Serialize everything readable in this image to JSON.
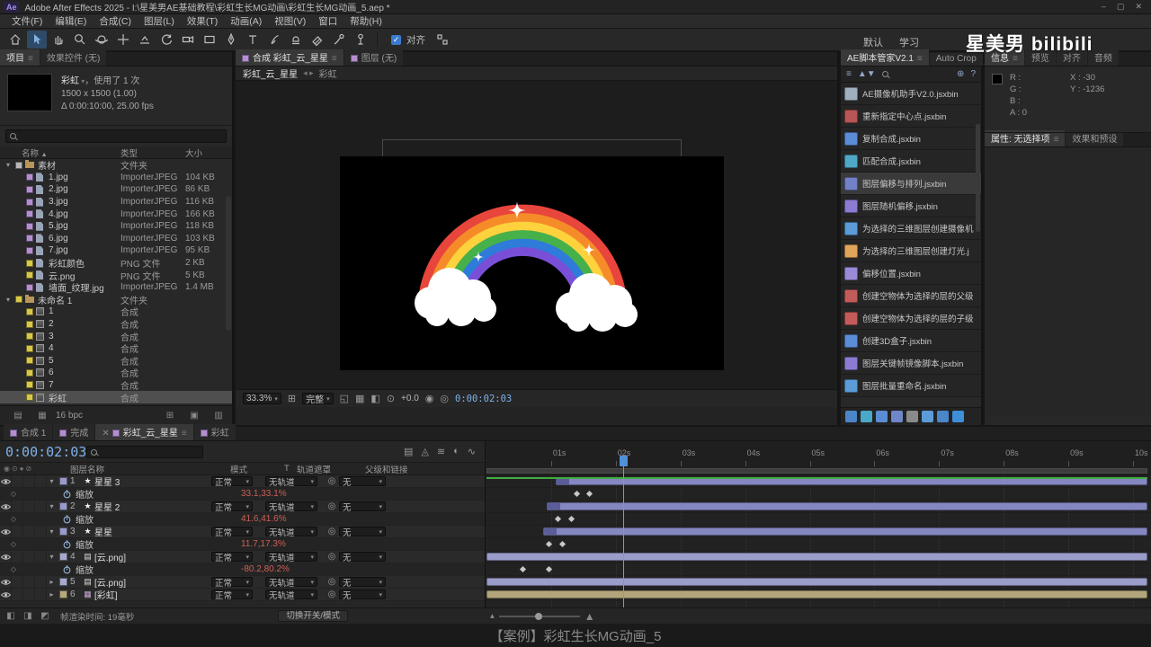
{
  "window": {
    "app_badge": "Ae",
    "title": "Adobe After Effects 2025 - I:\\星美男AE基础教程\\彩虹生长MG动画\\彩虹生长MG动画_5.aep *",
    "controls": [
      "–",
      "▢",
      "✕"
    ]
  },
  "menu": {
    "items": [
      "文件(F)",
      "编辑(E)",
      "合成(C)",
      "图层(L)",
      "效果(T)",
      "动画(A)",
      "视图(V)",
      "窗口",
      "帮助(H)"
    ]
  },
  "toolbar": {
    "snap_label": "对齐"
  },
  "workspace": {
    "items": [
      "默认",
      "学习"
    ],
    "watermark": "星美男  bilibili"
  },
  "project": {
    "tabs": [
      {
        "label": "项目",
        "active": true
      },
      {
        "label": "效果控件 (无)",
        "active": false
      }
    ],
    "preview": {
      "title": "彩虹",
      "usage": "，使用了 1 次",
      "dims": "1500 x 1500 (1.00)",
      "duration": "Δ 0:00:10:00, 25.00 fps"
    },
    "columns": {
      "name": "名称",
      "sort": "▲",
      "type": "类型",
      "size": "大小"
    },
    "items": [
      {
        "indent": 0,
        "kind": "folder",
        "open": true,
        "chip": "#b8b8b8",
        "name": "素材",
        "type": "文件夹",
        "size": ""
      },
      {
        "indent": 1,
        "kind": "footage",
        "chip": "#b48fd0",
        "name": "1.jpg",
        "type": "ImporterJPEG",
        "size": "104 KB"
      },
      {
        "indent": 1,
        "kind": "footage",
        "chip": "#b48fd0",
        "name": "2.jpg",
        "type": "ImporterJPEG",
        "size": "86 KB"
      },
      {
        "indent": 1,
        "kind": "footage",
        "chip": "#b48fd0",
        "name": "3.jpg",
        "type": "ImporterJPEG",
        "size": "116 KB"
      },
      {
        "indent": 1,
        "kind": "footage",
        "chip": "#b48fd0",
        "name": "4.jpg",
        "type": "ImporterJPEG",
        "size": "166 KB"
      },
      {
        "indent": 1,
        "kind": "footage",
        "chip": "#b48fd0",
        "name": "5.jpg",
        "type": "ImporterJPEG",
        "size": "118 KB"
      },
      {
        "indent": 1,
        "kind": "footage",
        "chip": "#b48fd0",
        "name": "6.jpg",
        "type": "ImporterJPEG",
        "size": "103 KB"
      },
      {
        "indent": 1,
        "kind": "footage",
        "chip": "#b48fd0",
        "name": "7.jpg",
        "type": "ImporterJPEG",
        "size": "95 KB"
      },
      {
        "indent": 1,
        "kind": "footage",
        "chip": "#d8c84a",
        "name": "彩虹颜色",
        "type": "PNG 文件",
        "size": "2 KB"
      },
      {
        "indent": 1,
        "kind": "footage",
        "chip": "#d8c84a",
        "name": "云.png",
        "type": "PNG 文件",
        "size": "5 KB"
      },
      {
        "indent": 1,
        "kind": "footage",
        "chip": "#b48fd0",
        "name": "墙面_纹理.jpg",
        "type": "ImporterJPEG",
        "size": "1.4 MB"
      },
      {
        "indent": 0,
        "kind": "folder",
        "open": true,
        "chip": "#d8c84a",
        "name": "未命名 1",
        "type": "文件夹",
        "size": ""
      },
      {
        "indent": 1,
        "kind": "comp",
        "chip": "#d8c84a",
        "name": "1",
        "type": "合成",
        "size": ""
      },
      {
        "indent": 1,
        "kind": "comp",
        "chip": "#d8c84a",
        "name": "2",
        "type": "合成",
        "size": ""
      },
      {
        "indent": 1,
        "kind": "comp",
        "chip": "#d8c84a",
        "name": "3",
        "type": "合成",
        "size": ""
      },
      {
        "indent": 1,
        "kind": "comp",
        "chip": "#d8c84a",
        "name": "4",
        "type": "合成",
        "size": ""
      },
      {
        "indent": 1,
        "kind": "comp",
        "chip": "#d8c84a",
        "name": "5",
        "type": "合成",
        "size": ""
      },
      {
        "indent": 1,
        "kind": "comp",
        "chip": "#d8c84a",
        "name": "6",
        "type": "合成",
        "size": ""
      },
      {
        "indent": 1,
        "kind": "comp",
        "chip": "#d8c84a",
        "name": "7",
        "type": "合成",
        "size": ""
      },
      {
        "indent": 1,
        "kind": "comp",
        "chip": "#d8c84a",
        "name": "彩虹",
        "type": "合成",
        "size": "",
        "selected": true
      }
    ],
    "footer": {
      "bpc": "16 bpc"
    }
  },
  "comp": {
    "tabs": [
      {
        "label": "合成 彩虹_云_星星",
        "active": true
      },
      {
        "label": "图层 (无)",
        "active": false
      }
    ],
    "nav": {
      "current": "彩虹_云_星星",
      "arrows": "◂ ▸",
      "other": "彩虹"
    },
    "controls": {
      "zoom": "33.3%",
      "resolution": "完整",
      "exposure": "+0.0",
      "timecode": "0:00:02:03"
    }
  },
  "viewport": {
    "bg": "#000000",
    "rainbow_colors": [
      "#e8453c",
      "#f68b29",
      "#fdd23c",
      "#46b14a",
      "#2f7bd9",
      "#7a4fd8"
    ],
    "cloud_color": "#ffffff",
    "star_color": "#ffffff"
  },
  "scripts": {
    "tabs": [
      {
        "label": "AE脚本管家V2.1",
        "active": true
      },
      {
        "label": "Auto Crop",
        "active": false
      }
    ],
    "items": [
      {
        "label": "AE摄像机助手V2.0.jsxbin",
        "color": "#9fb0c0"
      },
      {
        "label": "重新指定中心点.jsxbin",
        "color": "#b85555"
      },
      {
        "label": "复制合成.jsxbin",
        "color": "#5b8dd6"
      },
      {
        "label": "匹配合成.jsxbin",
        "color": "#4fa8c8"
      },
      {
        "label": "图层偏移与排列.jsxbin",
        "color": "#7381c9",
        "highlight": true
      },
      {
        "label": "图层随机偏移.jsxbin",
        "color": "#8d7bd3"
      },
      {
        "label": "为选择的三维图层创建摄像机",
        "color": "#5b9bd8"
      },
      {
        "label": "为选择的三维图层创建灯光.j",
        "color": "#e0a558"
      },
      {
        "label": "偏移位置.jsxbin",
        "color": "#9a8ad8"
      },
      {
        "label": "创建空物体为选择的层的父级",
        "color": "#c45b5b"
      },
      {
        "label": "创建空物体为选择的层的子级",
        "color": "#c45b5b"
      },
      {
        "label": "创建3D盒子.jsxbin",
        "color": "#5b8dd6"
      },
      {
        "label": "图层关键帧镜像脚本.jsxbin",
        "color": "#8d7bd3"
      },
      {
        "label": "图层批量重命名.jsxbin",
        "color": "#5b9bd8"
      }
    ],
    "quick_icons": [
      "#4a86c8",
      "#4aa8c8",
      "#5b8dd6",
      "#6f86c8",
      "#8a8a8a",
      "#5b9bd8",
      "#4a86c8",
      "#3f8fd8"
    ]
  },
  "info": {
    "tabs": [
      "信息",
      "预览",
      "对齐",
      "音频"
    ],
    "channels": [
      "R :",
      "G :",
      "B :",
      "A : 0"
    ],
    "coords": [
      "X : -30",
      "Y : -1236"
    ]
  },
  "props": {
    "tabs": [
      "属性: 无选择项",
      "效果和预设"
    ]
  },
  "timeline": {
    "tabs": [
      {
        "label": "合成 1",
        "active": false
      },
      {
        "label": "完成",
        "active": false
      },
      {
        "label": "彩虹_云_星星",
        "active": true,
        "closable": true
      },
      {
        "label": "彩虹",
        "active": false
      }
    ],
    "timecode": "0:00:02:03",
    "header": {
      "name": "图层名称",
      "mode": "模式",
      "t": "T",
      "trkmat": "轨道遮罩",
      "parent": "父级和链接"
    },
    "ruler": [
      "01s",
      "02s",
      "03s",
      "04s",
      "05s",
      "06s",
      "07s",
      "08s",
      "09s",
      "10s"
    ],
    "playhead_pct": 20.6,
    "layers": [
      {
        "num": "1",
        "type": "star",
        "name": "星星 3",
        "chip": "#989bc8",
        "mode": "正常",
        "trkmat": "无轨道",
        "parent": "无",
        "bar": {
          "start_pct": 10.4,
          "color": "#8487c0",
          "cap": true
        },
        "scale": {
          "label": "缩放",
          "value": "33.1,33.1%",
          "keys_pct": [
            13.2,
            15.1
          ]
        }
      },
      {
        "num": "2",
        "type": "star",
        "name": "星星 2",
        "chip": "#989bc8",
        "mode": "正常",
        "trkmat": "无轨道",
        "parent": "无",
        "bar": {
          "start_pct": 9.1,
          "color": "#8487c0",
          "cap": true
        },
        "scale": {
          "label": "缩放",
          "value": "41.6,41.6%",
          "keys_pct": [
            10.4,
            12.4
          ]
        }
      },
      {
        "num": "3",
        "type": "star",
        "name": "星星",
        "chip": "#989bc8",
        "mode": "正常",
        "trkmat": "无轨道",
        "parent": "无",
        "bar": {
          "start_pct": 8.5,
          "color": "#8487c0",
          "cap": true
        },
        "scale": {
          "label": "缩放",
          "value": "11.7,17.3%",
          "keys_pct": [
            9.0,
            11.1
          ]
        }
      },
      {
        "num": "4",
        "type": "footage",
        "name": "[云.png]",
        "chip": "#a8aacd",
        "mode": "正常",
        "trkmat": "无轨道",
        "parent": "无",
        "bar": {
          "start_pct": 0,
          "color": "#9a9cc9"
        },
        "scale": {
          "label": "缩放",
          "value": "-80.2,80.2%",
          "keys_pct": [
            5.1,
            9.0
          ]
        }
      },
      {
        "num": "5",
        "type": "footage",
        "name": "[云.png]",
        "chip": "#a8aacd",
        "mode": "正常",
        "trkmat": "无轨道",
        "parent": "无",
        "bar": {
          "start_pct": 0,
          "color": "#9a9cc9"
        }
      },
      {
        "num": "6",
        "type": "comp",
        "name": "[彩虹]",
        "chip": "#b5a87e",
        "mode": "正常",
        "trkmat": "无轨道",
        "parent": "无",
        "bar": {
          "start_pct": 0,
          "color": "#b2a57c"
        }
      }
    ],
    "footer": {
      "render": "帧渲染时间: 19毫秒",
      "toggle": "切换开关/模式"
    }
  },
  "caption": "【案例】彩虹生长MG动画_5"
}
